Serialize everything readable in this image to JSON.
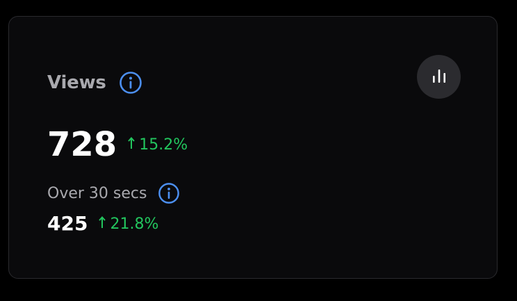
{
  "card": {
    "title": "Views",
    "info_icon": "info-circle-icon",
    "chart_button_icon": "bar-chart-icon",
    "metric": {
      "value": "728",
      "delta": "15.2%",
      "delta_direction": "up"
    },
    "sub_metric": {
      "label": "Over 30 secs",
      "info_icon": "info-circle-icon",
      "value": "425",
      "delta": "21.8%",
      "delta_direction": "up"
    }
  },
  "colors": {
    "background": "#000000",
    "card_background": "#0a0a0c",
    "card_border": "#2a2a2e",
    "title_text": "#a9a9ae",
    "value_text": "#ffffff",
    "positive_delta": "#22c55e",
    "info_accent": "#4c8ff0",
    "chart_button_bg": "#2b2b2f"
  }
}
